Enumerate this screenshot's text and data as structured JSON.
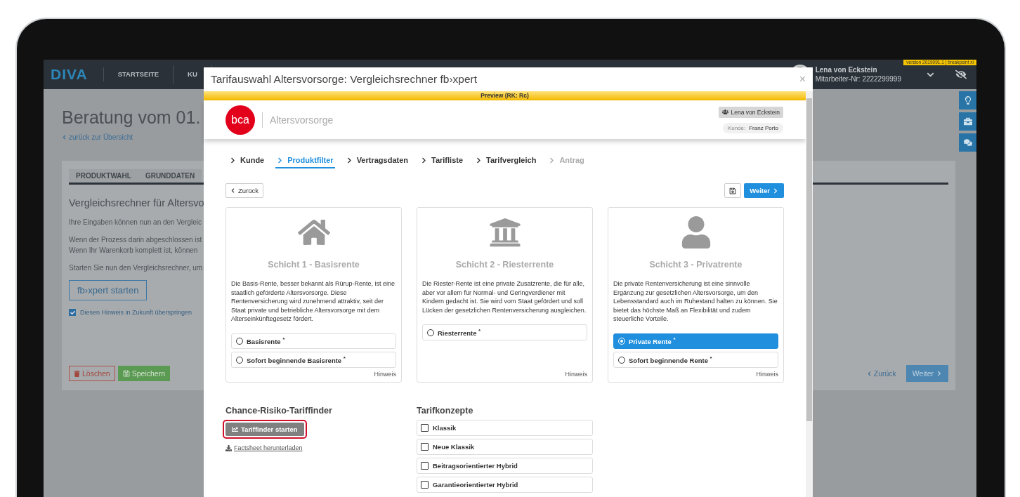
{
  "version_badge": "version 2019091.1 | breakpoint xl",
  "nav": {
    "logo": "DIVA",
    "items": [
      {
        "label": "STARTSEITE"
      },
      {
        "label": "KU"
      }
    ],
    "user": {
      "name": "Lena von Eckstein",
      "employee_no": "Mitarbeiter-Nr: 2222299999"
    }
  },
  "background": {
    "title": "Beratung vom 01.",
    "back_link": "zurück zur Übersicht",
    "tabs": [
      {
        "label": "PRODUKTWAHL"
      },
      {
        "label": "GRUNDDATEN"
      }
    ],
    "heading": "Vergleichsrechner für Altersvo",
    "paragraphs": [
      [
        "Ihre Eingaben können nun an den Vergleic"
      ],
      [
        "Wenn der Prozess darin abgeschlossen ist",
        "Wenn Ihr Warenkorb komplett ist, können"
      ],
      [
        "Starten Sie nun den Vergleichsrechner, um"
      ]
    ],
    "start_button": "fb›xpert starten",
    "skip_hint": {
      "label": "Diesen Hinweis in Zukunft überspringen",
      "checked": true
    },
    "delete_button": "Löschen",
    "save_button": "Speichern",
    "back_button": "Zurück",
    "next_button": "Weiter"
  },
  "modal": {
    "title": "Tarifauswahl Altersvorsorge: Vergleichsrechner fb›xpert",
    "close": "×",
    "preview": "Preview (RK: Rc)",
    "logo": "bca",
    "section": "Altersvorsorge",
    "advisor": "Lena von Eckstein",
    "customer_label": "Kunde:",
    "customer": "Franz Porto",
    "steps": [
      {
        "label": "Kunde",
        "selected": false,
        "disabled": false
      },
      {
        "label": "Produktfilter",
        "selected": true,
        "disabled": false
      },
      {
        "label": "Vertragsdaten",
        "selected": false,
        "disabled": false
      },
      {
        "label": "Tarifliste",
        "selected": false,
        "disabled": false
      },
      {
        "label": "Tarifvergleich",
        "selected": false,
        "disabled": false
      },
      {
        "label": "Antrag",
        "selected": false,
        "disabled": true
      }
    ],
    "back_button": "Zurück",
    "next_button": "Weiter",
    "products": [
      {
        "kind": "house",
        "title": "Schicht 1 - Basisrente",
        "description": "Die Basis-Rente, besser bekannt als Rürup-Rente, ist eine staatlich geförderte Altersvorsorge. Diese Rentenversicherung wird zunehmend attraktiv, seit der Staat private und betriebliche Altersvorsorge mit dem Alterseinkünftegesetz fördert.",
        "options": [
          {
            "label": "Basisrente $^{*}$",
            "selected": false
          },
          {
            "label": "Sofort beginnende Basisrente $^{*}$",
            "selected": false
          }
        ],
        "hint": "Hinweis"
      },
      {
        "kind": "bank",
        "title": "Schicht 2 - Riesterrente",
        "description": "Die Riester-Rente ist eine private Zusatzrente, die für alle, aber vor allem für Normal- und Geringverdiener mit Kindern gedacht ist. Sie wird vom Staat gefördert und soll Lücken der gesetzlichen Rentenversicherung ausgleichen.",
        "options": [
          {
            "label": "Riesterrente $^{*}$",
            "selected": false
          }
        ],
        "hint": "Hinweis"
      },
      {
        "kind": "person",
        "title": "Schicht 3 - Privatrente",
        "description": "Die private Rentenversicherung ist eine sinnvolle Ergänzung zur gesetzlichen Altersvorsorge, um den Lebensstandard auch im Ruhestand halten zu können. Sie bietet das höchste Maß an Flexibilität und zudem steuerliche Vorteile.",
        "options": [
          {
            "label": "Private Rente $^{*}$",
            "selected": true
          },
          {
            "label": "Sofort beginnende Rente $^{*}$",
            "selected": false
          }
        ],
        "hint": "Hinweis"
      }
    ],
    "tariff_finder": {
      "heading": "Chance-Risiko-Tariffinder",
      "button": "Tariffinder starten",
      "highlighted": true,
      "factsheet": "Factsheet herunterladen"
    },
    "concepts": {
      "heading": "Tarifkonzepte",
      "items": [
        {
          "label": "Klassik",
          "checked": false
        },
        {
          "label": "Neue Klassik",
          "checked": false
        },
        {
          "label": "Beitragsorientierter Hybrid",
          "checked": false
        },
        {
          "label": "Garantieorientierter Hybrid",
          "checked": false
        }
      ]
    }
  }
}
